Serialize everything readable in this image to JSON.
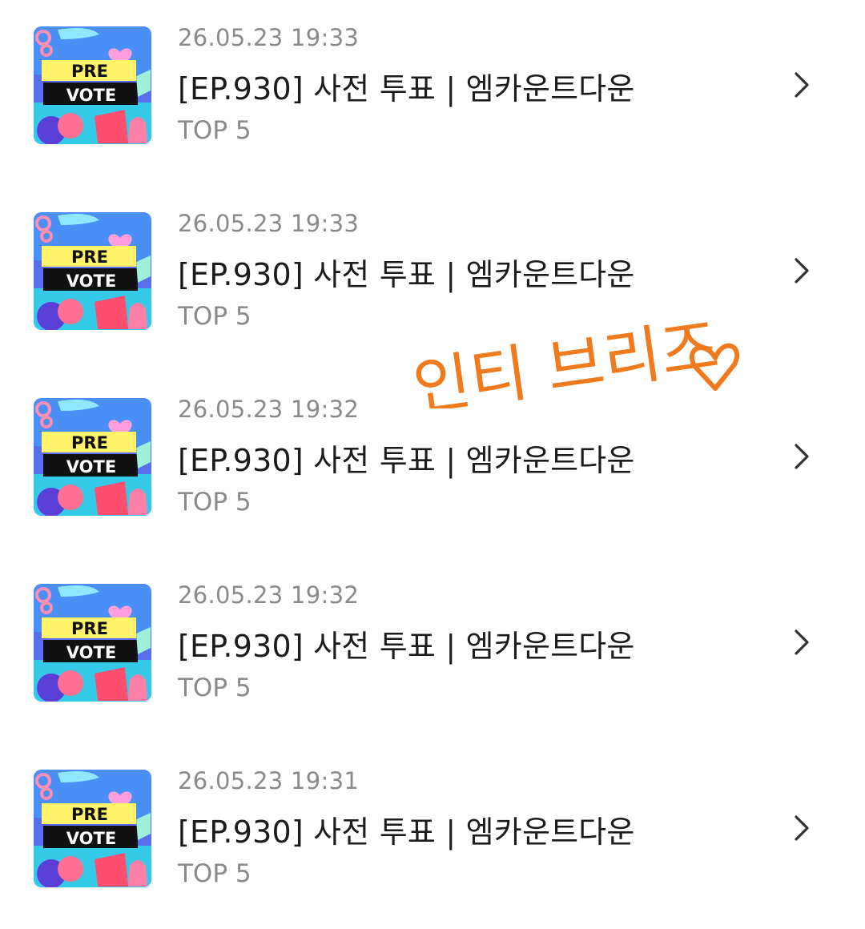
{
  "items": [
    {
      "date": "26.05.23 19:33",
      "title": "[EP.930] 사전 투표 | 엠카운트다운",
      "subtitle": "TOP 5",
      "thumbnail": {
        "line1": "PRE",
        "line2": "VOTE"
      }
    },
    {
      "date": "26.05.23 19:33",
      "title": "[EP.930] 사전 투표 | 엠카운트다운",
      "subtitle": "TOP 5",
      "thumbnail": {
        "line1": "PRE",
        "line2": "VOTE"
      }
    },
    {
      "date": "26.05.23 19:32",
      "title": "[EP.930] 사전 투표 | 엠카운트다운",
      "subtitle": "TOP 5",
      "thumbnail": {
        "line1": "PRE",
        "line2": "VOTE"
      }
    },
    {
      "date": "26.05.23 19:32",
      "title": "[EP.930] 사전 투표 | 엠카운트다운",
      "subtitle": "TOP 5",
      "thumbnail": {
        "line1": "PRE",
        "line2": "VOTE"
      }
    },
    {
      "date": "26.05.23 19:31",
      "title": "[EP.930] 사전 투표 | 엠카운트다운",
      "subtitle": "TOP 5",
      "thumbnail": {
        "line1": "PRE",
        "line2": "VOTE"
      }
    }
  ],
  "handwriting": {
    "text": "인티 브리즈",
    "color": "#f07a1e",
    "icon": "heart-icon"
  },
  "icons": {
    "row_chevron": "chevron-right-icon"
  },
  "colors": {
    "date_text": "#8a8a8a",
    "title_text": "#1c1c1c",
    "chevron": "#333333"
  }
}
